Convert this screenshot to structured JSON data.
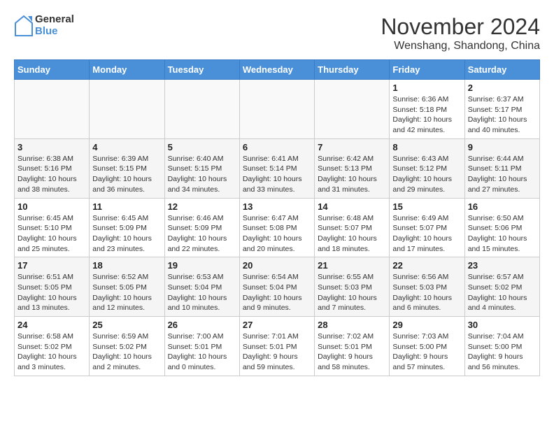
{
  "header": {
    "logo_line1": "General",
    "logo_line2": "Blue",
    "month": "November 2024",
    "location": "Wenshang, Shandong, China"
  },
  "weekdays": [
    "Sunday",
    "Monday",
    "Tuesday",
    "Wednesday",
    "Thursday",
    "Friday",
    "Saturday"
  ],
  "weeks": [
    [
      {
        "day": "",
        "info": "",
        "empty": true
      },
      {
        "day": "",
        "info": "",
        "empty": true
      },
      {
        "day": "",
        "info": "",
        "empty": true
      },
      {
        "day": "",
        "info": "",
        "empty": true
      },
      {
        "day": "",
        "info": "",
        "empty": true
      },
      {
        "day": "1",
        "info": "Sunrise: 6:36 AM\nSunset: 5:18 PM\nDaylight: 10 hours\nand 42 minutes.",
        "empty": false
      },
      {
        "day": "2",
        "info": "Sunrise: 6:37 AM\nSunset: 5:17 PM\nDaylight: 10 hours\nand 40 minutes.",
        "empty": false
      }
    ],
    [
      {
        "day": "3",
        "info": "Sunrise: 6:38 AM\nSunset: 5:16 PM\nDaylight: 10 hours\nand 38 minutes.",
        "empty": false
      },
      {
        "day": "4",
        "info": "Sunrise: 6:39 AM\nSunset: 5:15 PM\nDaylight: 10 hours\nand 36 minutes.",
        "empty": false
      },
      {
        "day": "5",
        "info": "Sunrise: 6:40 AM\nSunset: 5:15 PM\nDaylight: 10 hours\nand 34 minutes.",
        "empty": false
      },
      {
        "day": "6",
        "info": "Sunrise: 6:41 AM\nSunset: 5:14 PM\nDaylight: 10 hours\nand 33 minutes.",
        "empty": false
      },
      {
        "day": "7",
        "info": "Sunrise: 6:42 AM\nSunset: 5:13 PM\nDaylight: 10 hours\nand 31 minutes.",
        "empty": false
      },
      {
        "day": "8",
        "info": "Sunrise: 6:43 AM\nSunset: 5:12 PM\nDaylight: 10 hours\nand 29 minutes.",
        "empty": false
      },
      {
        "day": "9",
        "info": "Sunrise: 6:44 AM\nSunset: 5:11 PM\nDaylight: 10 hours\nand 27 minutes.",
        "empty": false
      }
    ],
    [
      {
        "day": "10",
        "info": "Sunrise: 6:45 AM\nSunset: 5:10 PM\nDaylight: 10 hours\nand 25 minutes.",
        "empty": false
      },
      {
        "day": "11",
        "info": "Sunrise: 6:45 AM\nSunset: 5:09 PM\nDaylight: 10 hours\nand 23 minutes.",
        "empty": false
      },
      {
        "day": "12",
        "info": "Sunrise: 6:46 AM\nSunset: 5:09 PM\nDaylight: 10 hours\nand 22 minutes.",
        "empty": false
      },
      {
        "day": "13",
        "info": "Sunrise: 6:47 AM\nSunset: 5:08 PM\nDaylight: 10 hours\nand 20 minutes.",
        "empty": false
      },
      {
        "day": "14",
        "info": "Sunrise: 6:48 AM\nSunset: 5:07 PM\nDaylight: 10 hours\nand 18 minutes.",
        "empty": false
      },
      {
        "day": "15",
        "info": "Sunrise: 6:49 AM\nSunset: 5:07 PM\nDaylight: 10 hours\nand 17 minutes.",
        "empty": false
      },
      {
        "day": "16",
        "info": "Sunrise: 6:50 AM\nSunset: 5:06 PM\nDaylight: 10 hours\nand 15 minutes.",
        "empty": false
      }
    ],
    [
      {
        "day": "17",
        "info": "Sunrise: 6:51 AM\nSunset: 5:05 PM\nDaylight: 10 hours\nand 13 minutes.",
        "empty": false
      },
      {
        "day": "18",
        "info": "Sunrise: 6:52 AM\nSunset: 5:05 PM\nDaylight: 10 hours\nand 12 minutes.",
        "empty": false
      },
      {
        "day": "19",
        "info": "Sunrise: 6:53 AM\nSunset: 5:04 PM\nDaylight: 10 hours\nand 10 minutes.",
        "empty": false
      },
      {
        "day": "20",
        "info": "Sunrise: 6:54 AM\nSunset: 5:04 PM\nDaylight: 10 hours\nand 9 minutes.",
        "empty": false
      },
      {
        "day": "21",
        "info": "Sunrise: 6:55 AM\nSunset: 5:03 PM\nDaylight: 10 hours\nand 7 minutes.",
        "empty": false
      },
      {
        "day": "22",
        "info": "Sunrise: 6:56 AM\nSunset: 5:03 PM\nDaylight: 10 hours\nand 6 minutes.",
        "empty": false
      },
      {
        "day": "23",
        "info": "Sunrise: 6:57 AM\nSunset: 5:02 PM\nDaylight: 10 hours\nand 4 minutes.",
        "empty": false
      }
    ],
    [
      {
        "day": "24",
        "info": "Sunrise: 6:58 AM\nSunset: 5:02 PM\nDaylight: 10 hours\nand 3 minutes.",
        "empty": false
      },
      {
        "day": "25",
        "info": "Sunrise: 6:59 AM\nSunset: 5:02 PM\nDaylight: 10 hours\nand 2 minutes.",
        "empty": false
      },
      {
        "day": "26",
        "info": "Sunrise: 7:00 AM\nSunset: 5:01 PM\nDaylight: 10 hours\nand 0 minutes.",
        "empty": false
      },
      {
        "day": "27",
        "info": "Sunrise: 7:01 AM\nSunset: 5:01 PM\nDaylight: 9 hours\nand 59 minutes.",
        "empty": false
      },
      {
        "day": "28",
        "info": "Sunrise: 7:02 AM\nSunset: 5:01 PM\nDaylight: 9 hours\nand 58 minutes.",
        "empty": false
      },
      {
        "day": "29",
        "info": "Sunrise: 7:03 AM\nSunset: 5:00 PM\nDaylight: 9 hours\nand 57 minutes.",
        "empty": false
      },
      {
        "day": "30",
        "info": "Sunrise: 7:04 AM\nSunset: 5:00 PM\nDaylight: 9 hours\nand 56 minutes.",
        "empty": false
      }
    ]
  ]
}
